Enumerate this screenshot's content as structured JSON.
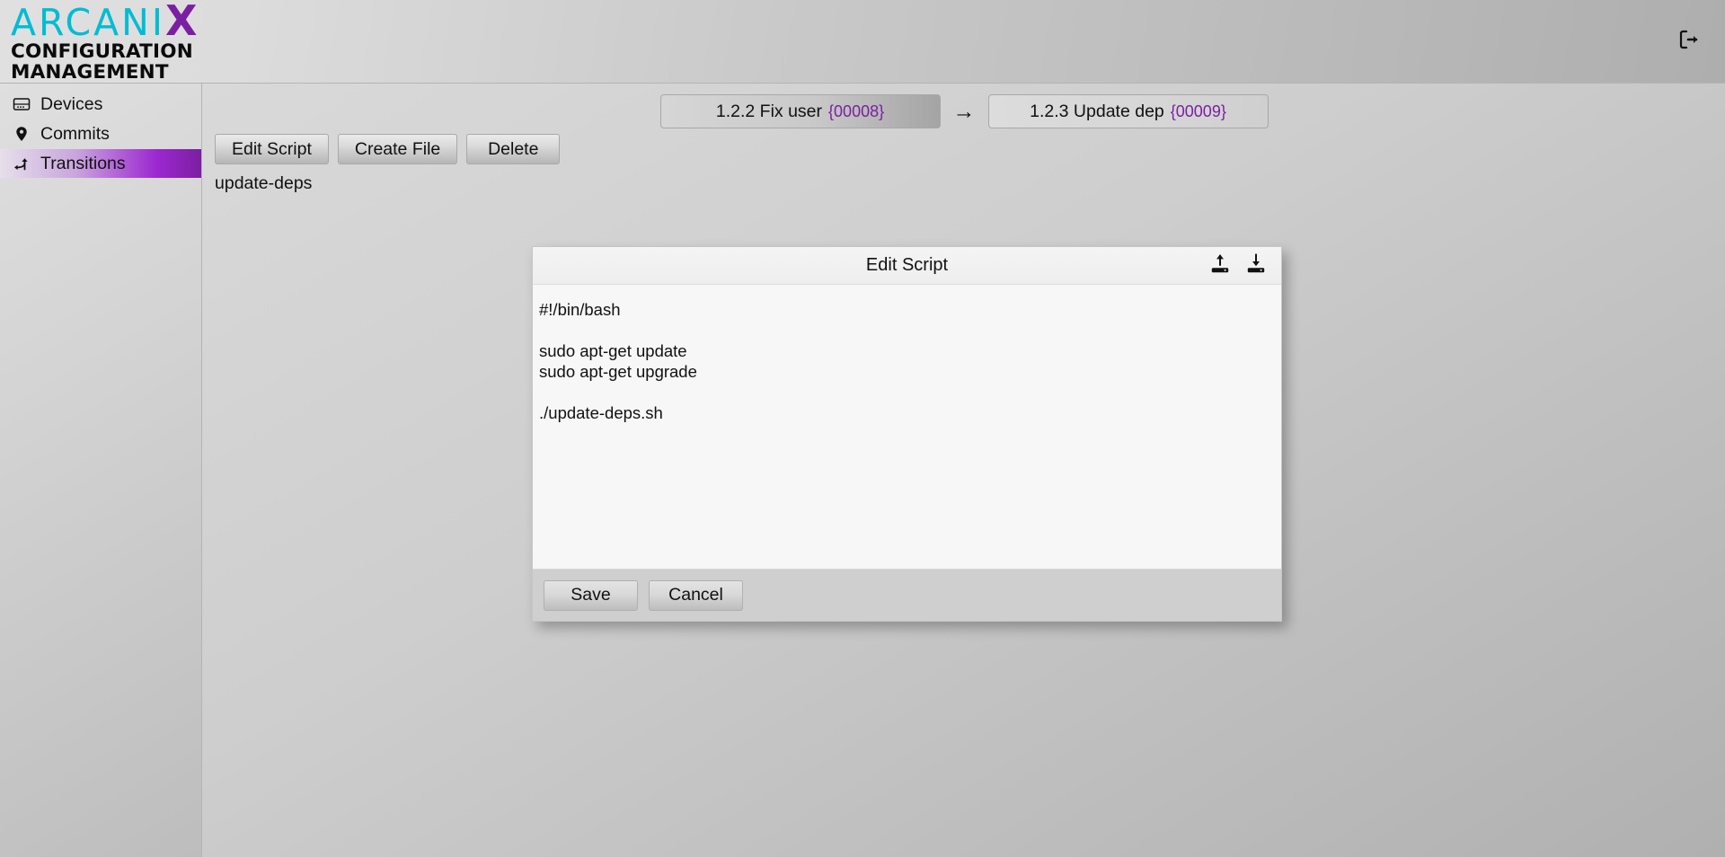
{
  "header": {
    "logo_main": "ARCANI",
    "logo_accent": "X",
    "logo_sub_line1": "CONFIGURATION",
    "logo_sub_line2": "MANAGEMENT",
    "logout_label": "Logout",
    "colors": {
      "logo_cyan": "#00bcd4",
      "logo_purple": "#7b1fa2"
    }
  },
  "sidebar": {
    "items": [
      {
        "label": "Devices",
        "icon": "server-icon",
        "active": false
      },
      {
        "label": "Commits",
        "icon": "map-pin-icon",
        "active": false
      },
      {
        "label": "Transitions",
        "icon": "branch-arrow-icon",
        "active": true
      }
    ]
  },
  "transition": {
    "from": {
      "name": "1.2.2 Fix user",
      "id": "{00008}"
    },
    "arrow": "→",
    "to": {
      "name": "1.2.3 Update dep",
      "id": "{00009}"
    },
    "id_color": "#7b1fa2"
  },
  "toolbar": {
    "edit_script_label": "Edit Script",
    "create_file_label": "Create File",
    "delete_label": "Delete"
  },
  "content": {
    "file_name": "update-deps"
  },
  "dialog": {
    "title": "Edit Script",
    "upload_icon": "upload-icon",
    "download_icon": "download-icon",
    "script_text": "#!/bin/bash\n\nsudo apt-get update\nsudo apt-get upgrade\n\n./update-deps.sh",
    "save_label": "Save",
    "cancel_label": "Cancel"
  }
}
